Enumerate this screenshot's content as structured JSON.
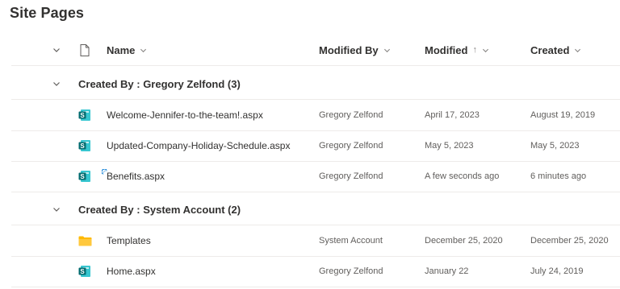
{
  "page": {
    "title": "Site Pages"
  },
  "header": {
    "name": "Name",
    "modified_by": "Modified By",
    "modified": "Modified",
    "modified_sort_arrow": "↑",
    "created": "Created"
  },
  "groups": [
    {
      "label": "Created By : Gregory Zelfond (3)",
      "items": [
        {
          "name": "Welcome-Jennifer-to-the-team!.aspx",
          "modified_by": "Gregory Zelfond",
          "modified": "April 17, 2023",
          "created": "August 19, 2019",
          "icon": "sharepoint-page-icon"
        },
        {
          "name": "Updated-Company-Holiday-Schedule.aspx",
          "modified_by": "Gregory Zelfond",
          "modified": "May 5, 2023",
          "created": "May 5, 2023",
          "icon": "sharepoint-page-icon"
        },
        {
          "name": "Benefits.aspx",
          "modified_by": "Gregory Zelfond",
          "modified": "A few seconds ago",
          "created": "6 minutes ago",
          "icon": "sharepoint-page-icon"
        }
      ]
    },
    {
      "label": "Created By : System Account (2)",
      "items": [
        {
          "name": "Templates",
          "modified_by": "System Account",
          "modified": "December 25, 2020",
          "created": "December 25, 2020",
          "icon": "folder-icon"
        },
        {
          "name": "Home.aspx",
          "modified_by": "Gregory Zelfond",
          "modified": "January 22",
          "created": "July 24, 2019",
          "icon": "sharepoint-page-icon"
        }
      ]
    }
  ],
  "colors": {
    "sharepoint_teal": "#036c70",
    "folder_yellow": "#ffb900",
    "border": "#edebe9",
    "muted_text": "#605e5c"
  }
}
